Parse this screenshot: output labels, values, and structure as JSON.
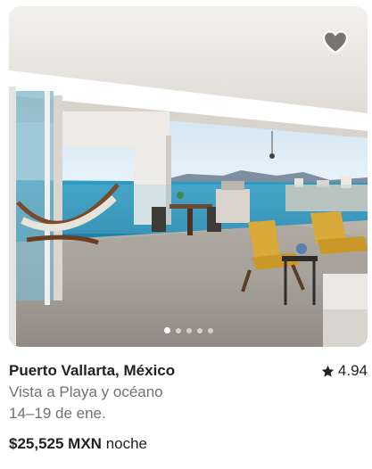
{
  "listing": {
    "location": "Puerto Vallarta, México",
    "rating": "4.94",
    "description": "Vista a Playa y océano",
    "dates": "14–19 de ene.",
    "price": "$25,525 MXN",
    "price_unit": "noche"
  },
  "carousel": {
    "total_dots": 5,
    "active_index": 0
  },
  "icons": {
    "favorite": "heart-icon",
    "rating": "star-icon"
  },
  "colors": {
    "text_primary": "#222222",
    "text_secondary": "#717171"
  }
}
